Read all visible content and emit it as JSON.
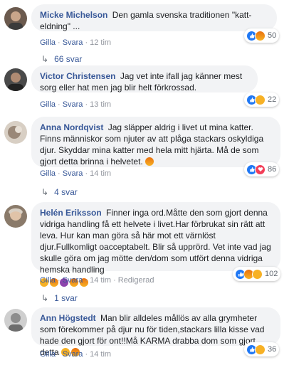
{
  "comments": [
    {
      "author": "Micke Michelson",
      "text": "Den gamla svenska traditionen \"katt-eldning\" ...",
      "reaction_count": "50",
      "actions": {
        "like": "Gilla",
        "reply": "Svara",
        "time": "12 tim"
      },
      "replies_label": "66 svar"
    },
    {
      "author": "Victor Christensen",
      "text": "Jag vet inte ifall jag känner mest sorg eller hat men jag blir helt förkrossad.",
      "reaction_count": "22",
      "actions": {
        "like": "Gilla",
        "reply": "Svara",
        "time": "13 tim"
      }
    },
    {
      "author": "Anna Nordqvist",
      "text": "Jag släpper aldrig i livet ut mina katter. Finns människor som njuter av att plåga stackars oskyldiga djur. Skyddar mina katter med hela mitt hjärta. Må de som gjort detta brinna i helvetet.",
      "reaction_count": "86",
      "actions": {
        "like": "Gilla",
        "reply": "Svara",
        "time": "14 tim"
      },
      "replies_label": "4 svar"
    },
    {
      "author": "Helén Eriksson",
      "text": "Finner inga ord.Måtte den som gjort denna vidriga handling få ett helvete i livet.Har förbrukat sin rätt att leva. Hur kan man göra så här mot ett värnlöst djur.Fullkomligt oacceptabelt. Blir så upprörd. Vet inte vad jag skulle göra om jag mötte den/dom som utfört denna vidriga hemska handling",
      "reaction_count": "102",
      "actions": {
        "like": "Gilla",
        "reply": "Svara",
        "time": "14 tim",
        "edited": "Redigerad"
      },
      "replies_label": "1 svar"
    },
    {
      "author": "Ann Högstedt",
      "text": "Man blir alldeles mållös av alla grymheter som förekommer på djur nu för tiden,stackars lilla kisse vad hade den gjort för ont!!Må KARMA drabba dom som gjort detta",
      "reaction_count": "36",
      "actions": {
        "like": "Gilla",
        "reply": "Svara",
        "time": "14 tim"
      }
    }
  ],
  "colors": {
    "author": "#385898",
    "bubble": "#f2f3f5",
    "meta": "#90949c",
    "like_blue": "#2078f4"
  }
}
